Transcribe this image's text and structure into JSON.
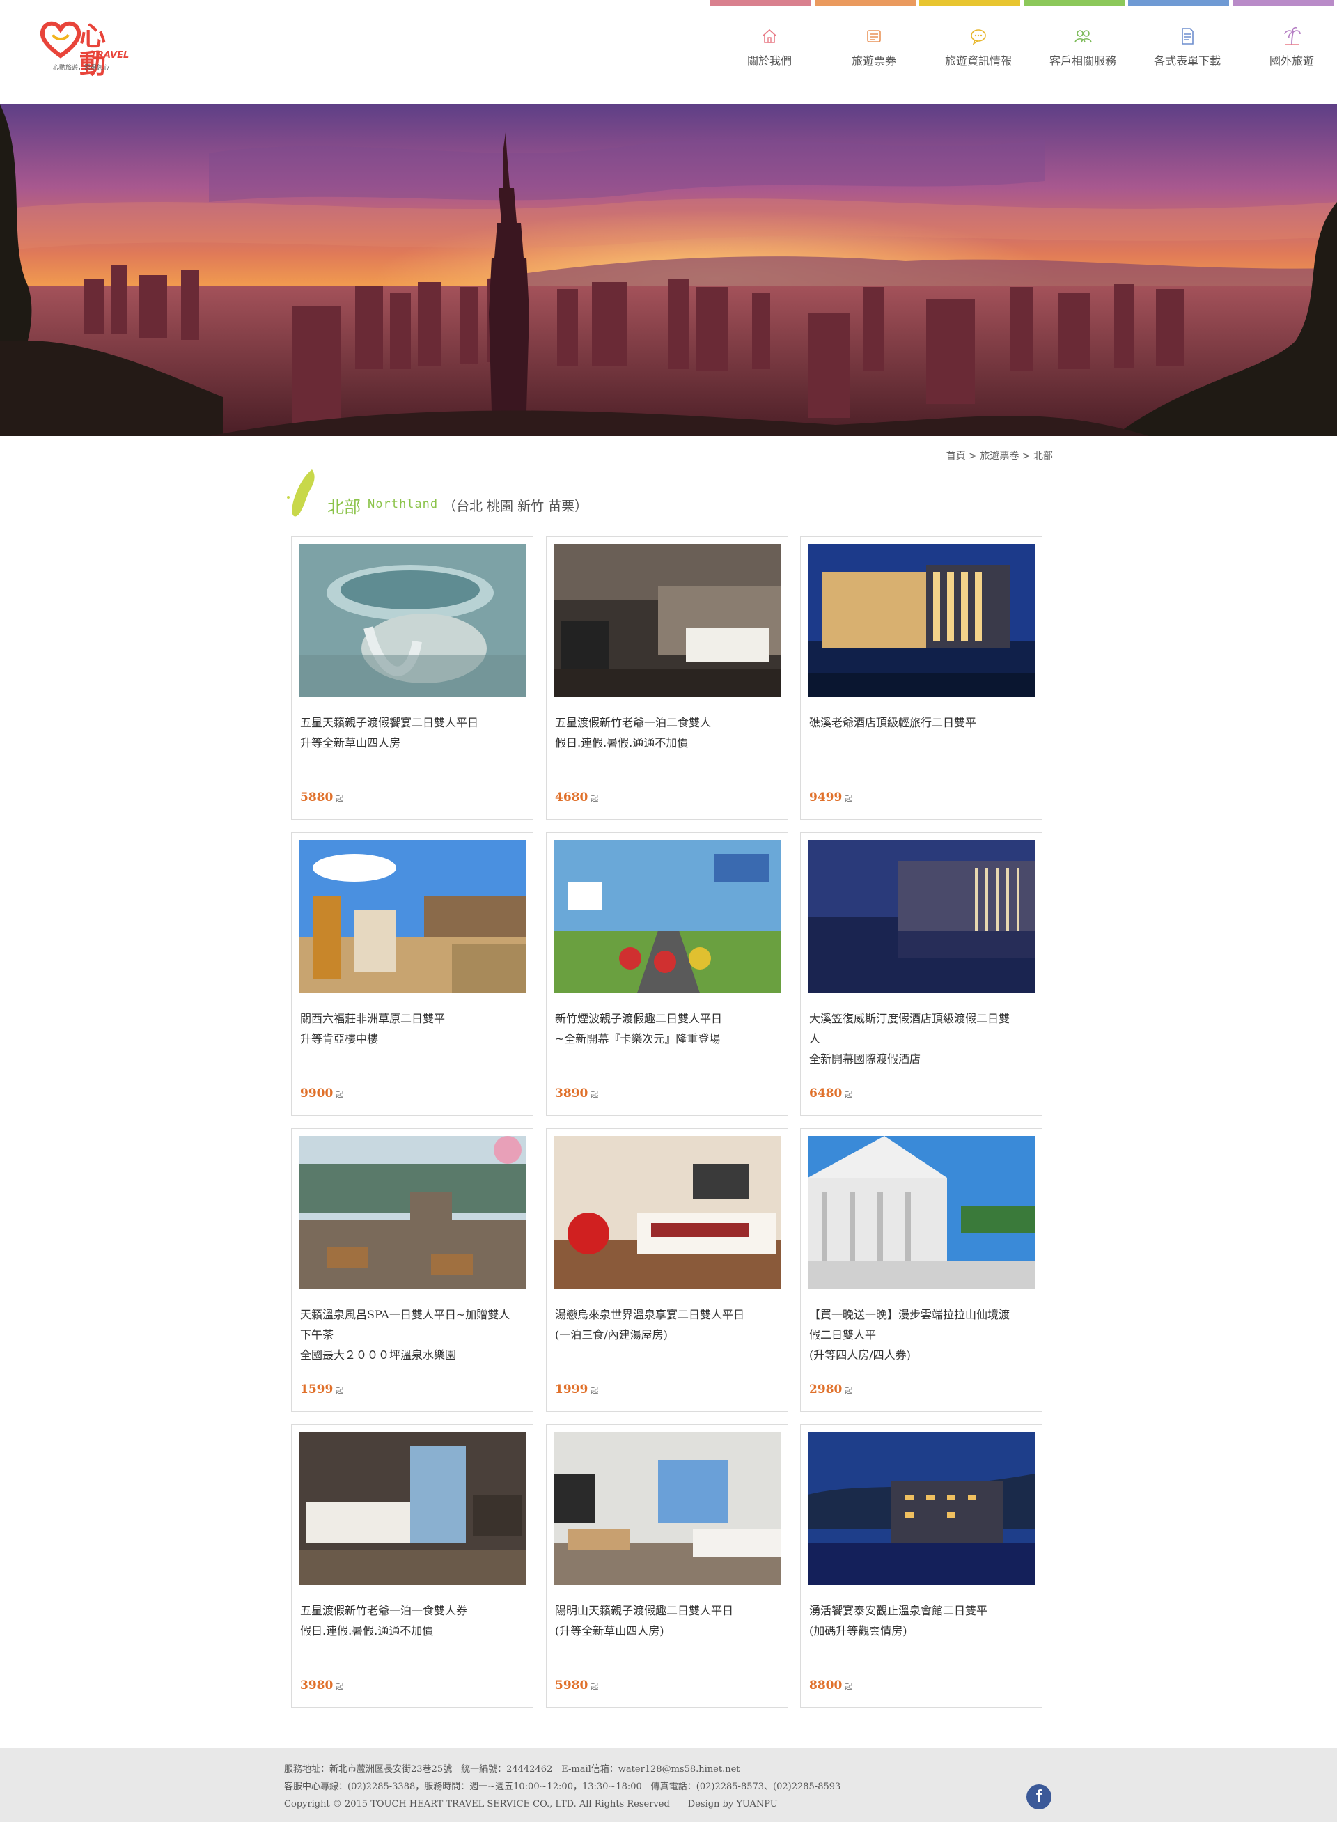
{
  "header": {
    "logo": {
      "brand": "心動",
      "brand_en": "TRAVEL",
      "slogan": "心動旅遊，深得您心"
    },
    "strip_colors": [
      "#d9808e",
      "#ea9a5e",
      "#e8c530",
      "#8cc85a",
      "#6f9ad4",
      "#b98bc8"
    ],
    "nav": [
      {
        "label": "關於我們",
        "icon": "home-icon",
        "color": "#e87a86"
      },
      {
        "label": "旅遊票券",
        "icon": "ticket-icon",
        "color": "#e9945a"
      },
      {
        "label": "旅遊資訊情報",
        "icon": "chat-bubble-icon",
        "color": "#e8b830"
      },
      {
        "label": "客戶相關服務",
        "icon": "people-icon",
        "color": "#7dbb5a"
      },
      {
        "label": "各式表單下載",
        "icon": "document-icon",
        "color": "#6f8fcf"
      },
      {
        "label": "國外旅遊",
        "icon": "palm-tree-icon",
        "color": "#b57fc4"
      }
    ]
  },
  "breadcrumb": {
    "home": "首頁",
    "sep": ">",
    "level1": "旅遊票卷",
    "level2": "北部"
  },
  "section": {
    "zh": "北部",
    "en": "Northland",
    "sub": "（台北 桃園 新竹 苗栗）"
  },
  "products": [
    {
      "line1": "五星天籟親子渡假饗宴二日雙人平日",
      "line2": "升等全新草山四人房",
      "line3": "",
      "price": "5880",
      "unit": "起",
      "image": "fountain-pool"
    },
    {
      "line1": "五星渡假新竹老爺一泊二食雙人",
      "line2": "假日.連假.暑假.通通不加價",
      "line3": "",
      "price": "4680",
      "unit": "起",
      "image": "hotel-room"
    },
    {
      "line1": "礁溪老爺酒店頂級輕旅行二日雙平",
      "line2": "",
      "line3": "",
      "price": "9499",
      "unit": "起",
      "image": "hotel-night"
    },
    {
      "line1": "關西六福莊非洲草原二日雙平",
      "line2": "升等肯亞樓中樓",
      "line3": "",
      "price": "9900",
      "unit": "起",
      "image": "safari-family"
    },
    {
      "line1": "新竹煙波親子渡假趣二日雙人平日",
      "line2": "~全新開幕『卡樂次元』隆重登場",
      "line3": "",
      "price": "3890",
      "unit": "起",
      "image": "kids-bikes"
    },
    {
      "line1": "大溪笠復威斯汀度假酒店頂級渡假二日雙",
      "line2": "人",
      "line3": "全新開幕國際渡假酒店",
      "price": "6480",
      "unit": "起",
      "image": "westin-night"
    },
    {
      "line1": "天籟溫泉風呂SPA一日雙人平日~加贈雙人",
      "line2": "下午茶",
      "line3": "全國最大２０００坪溫泉水樂園",
      "price": "1599",
      "unit": "起",
      "image": "hot-spring-deck"
    },
    {
      "line1": "湯戀烏來泉世界溫泉享宴二日雙人平日",
      "line2": "(一泊三食/內建湯屋房)",
      "line3": "",
      "price": "1999",
      "unit": "起",
      "image": "red-room"
    },
    {
      "line1": "【買一晚送一晚】漫步雲端拉拉山仙境渡",
      "line2": "假二日雙人平",
      "line3": "(升等四人房/四人券)",
      "price": "2980",
      "unit": "起",
      "image": "white-villa"
    },
    {
      "line1": "五星渡假新竹老爺一泊一食雙人券",
      "line2": "假日.連假.暑假.通通不加價",
      "line3": "",
      "price": "3980",
      "unit": "起",
      "image": "dark-room"
    },
    {
      "line1": "陽明山天籟親子渡假趣二日雙人平日",
      "line2": "(升等全新草山四人房)",
      "line3": "",
      "price": "5980",
      "unit": "起",
      "image": "bright-room"
    },
    {
      "line1": "湧活饗宴泰安觀止溫泉會館二日雙平",
      "line2": "(加碼升等觀雲情房)",
      "line3": "",
      "price": "8800",
      "unit": "起",
      "image": "resort-dusk"
    }
  ],
  "footer": {
    "line1": "服務地址：新北市蘆洲區長安街23巷25號　統一編號：24442462　E-mail信箱：water128@ms58.hinet.net",
    "line2": "客服中心專線：(02)2285-3388，服務時間：週一~週五10:00~12:00，13:30~18:00　傳真電話：(02)2285-8573、(02)2285-8593",
    "line3": "Copyright © 2015 TOUCH HEART TRAVEL SERVICE CO., LTD. All Rights Reserved　　Design by YUANPU",
    "fb_label": "f"
  }
}
